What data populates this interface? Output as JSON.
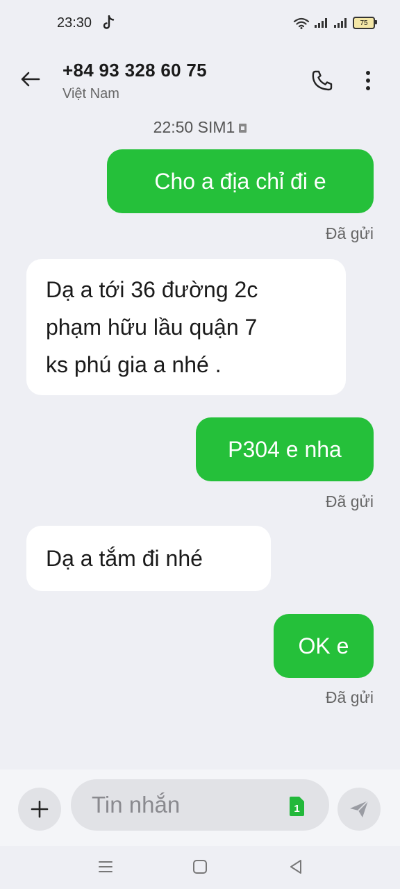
{
  "status_bar": {
    "time": "23:30",
    "battery": "75",
    "icons": [
      "tiktok-icon",
      "wifi-icon",
      "signal-icon",
      "signal-icon",
      "battery-icon"
    ]
  },
  "header": {
    "contact_number": "+84 93 328 60 75",
    "contact_country": "Việt Nam",
    "icons": [
      "back-arrow-icon",
      "phone-icon",
      "more-vert-icon"
    ]
  },
  "conversation": {
    "meta": "22:50 SIM1",
    "messages": [
      {
        "direction": "sent",
        "text": "Cho a địa chỉ đi e",
        "status": "Đã gửi"
      },
      {
        "direction": "received",
        "lines": [
          "Dạ a tới 36 đường 2c",
          "phạm hữu lầu quận 7",
          "ks phú gia a nhé ."
        ]
      },
      {
        "direction": "sent",
        "text": "P304 e nha",
        "status": "Đã gửi"
      },
      {
        "direction": "received",
        "lines": [
          "Dạ a tắm đi nhé"
        ]
      },
      {
        "direction": "sent",
        "text": "OK e",
        "status": "Đã gửi"
      }
    ]
  },
  "composer": {
    "placeholder": "Tin nhắn",
    "sim_number": "1",
    "colors": {
      "sim_badge": "#22b83a",
      "sent_bubble": "#25c03a"
    },
    "icons": [
      "plus-icon",
      "sim-card-icon",
      "send-icon"
    ]
  },
  "nav": {
    "icons": [
      "menu-icon",
      "home-icon",
      "back-nav-icon"
    ]
  }
}
